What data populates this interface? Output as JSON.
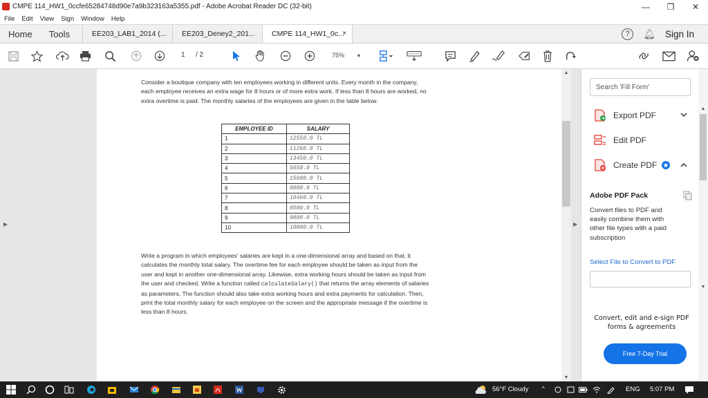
{
  "window": {
    "title": "CMPE 114_HW1_0ccfe65284748d90e7a9b323163a5355.pdf - Adobe Acrobat Reader DC (32-bit)",
    "minimize": "—",
    "maximize": "❐",
    "close": "✕"
  },
  "menu": [
    "File",
    "Edit",
    "View",
    "Sign",
    "Window",
    "Help"
  ],
  "tabs": {
    "home": "Home",
    "tools": "Tools",
    "docs": [
      {
        "label": "EE203_LAB1_2014 (..."
      },
      {
        "label": "EE203_Deney2_201..."
      },
      {
        "label": "CMPE 114_HW1_0c...",
        "close": "×"
      }
    ],
    "help": "?",
    "sign_in": "Sign In"
  },
  "toolbar": {
    "page_current": "1",
    "page_total": "/ 2",
    "zoom": "75%"
  },
  "document": {
    "intro": "Consider a boutique company with ten employees working in different units. Every month in the company, each employee receives an extra wage for 8 hours or of more extra work. If less than 8 hours are worked, no extra overtime is paid. The monthly salaries of the employees are given in the table below.",
    "table": {
      "headers": [
        "EMPLOYEE ID",
        "SALARY"
      ],
      "rows": [
        [
          "1",
          "12550.0 TL"
        ],
        [
          "2",
          "11260.0 TL"
        ],
        [
          "3",
          "13450.0 TL"
        ],
        [
          "4",
          "5650.0 TL"
        ],
        [
          "5",
          "15600.0 TL"
        ],
        [
          "6",
          "8000.0 TL"
        ],
        [
          "7",
          "10460.0 TL"
        ],
        [
          "8",
          "8500.0 TL"
        ],
        [
          "9",
          "9800.0 TL"
        ],
        [
          "10",
          "10000.0 TL"
        ]
      ]
    },
    "task_before_code": "Write a program in which employees' salaries are kept in a one-dimensional array and based on that, it calculates the monthly total salary. The overtime fee for each employee should be taken as input from the user and kept in another one-dimensional array. Likewise, extra working hours should be taken as input from the user and checked. Write a function called ",
    "task_code": "calculateSalary()",
    "task_after_code": " that returns the array elements of salaries as parameters. The function should also take extra working hours and extra payments for calculation. Then, print the total monthly salary for each employee on the screen and the appropriate message if the overtime is less than 8 hours."
  },
  "right_panel": {
    "search_placeholder": "Search 'Fill Form'",
    "tools": [
      {
        "label": "Export PDF",
        "icon": "export-pdf-icon",
        "color": "#e8433a"
      },
      {
        "label": "Edit PDF",
        "icon": "edit-pdf-icon",
        "color": "#e8433a"
      },
      {
        "label": "Create PDF",
        "icon": "create-pdf-icon",
        "color": "#e8433a"
      }
    ],
    "pack_title": "Adobe PDF Pack",
    "pack_desc": "Convert files to PDF and easily combine them with other file types with a paid subscription",
    "select_file": "Select File to Convert to PDF",
    "promo": "Convert, edit and e-sign PDF forms & agreements",
    "trial_button": "Free 7-Day Trial"
  },
  "taskbar": {
    "weather": "56°F Cloudy",
    "language": "ENG",
    "time": "5:07 PM"
  },
  "colors": {
    "accent": "#1473e6",
    "adobe_red": "#d62b1f",
    "taskbar": "#1f1f1f"
  }
}
